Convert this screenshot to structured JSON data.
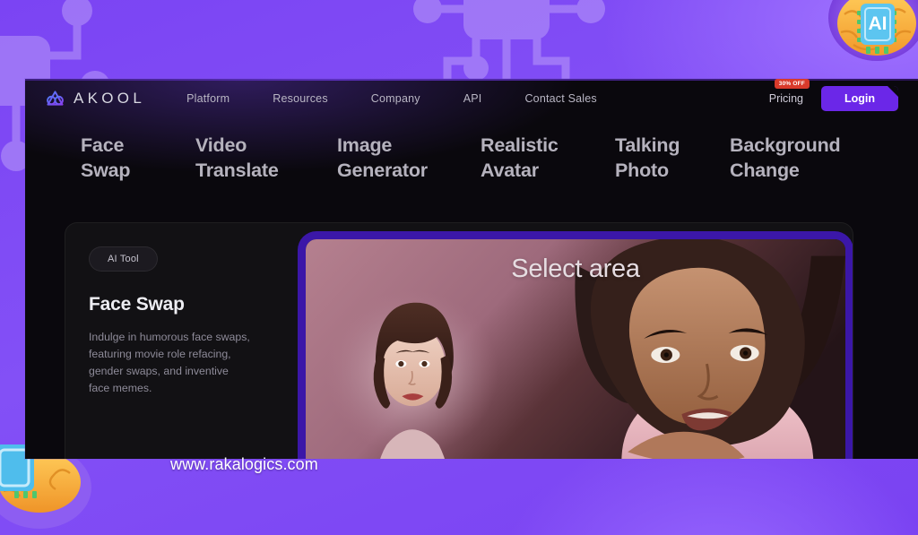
{
  "brand": {
    "logo_word": "AKOOL",
    "logo_icon": "akool-triangle-logo"
  },
  "topnav": {
    "links": [
      {
        "label": "Platform"
      },
      {
        "label": "Resources"
      },
      {
        "label": "Company"
      },
      {
        "label": "API"
      },
      {
        "label": "Contact Sales"
      }
    ],
    "pricing_label": "Pricing",
    "discount_badge": "30% OFF",
    "login_label": "Login",
    "accent_color": "#6b27e8",
    "badge_color": "#d93a2b"
  },
  "categories": [
    {
      "label": "Face\nSwap"
    },
    {
      "label": "Video\nTranslate"
    },
    {
      "label": "Image\nGenerator"
    },
    {
      "label": "Realistic\nAvatar"
    },
    {
      "label": "Talking\nPhoto"
    },
    {
      "label": "Background\nChange"
    }
  ],
  "card": {
    "chip_label": "AI Tool",
    "title": "Face Swap",
    "description": "Indulge in humorous face swaps, featuring movie role refacing, gender swaps, and inventive face memes.",
    "media_overlay_label": "Select area",
    "media_frame_color": "#3b17a8"
  },
  "watermark": {
    "text": "www.rakalogics.com"
  },
  "background": {
    "base_color": "#7d46f5",
    "decorations": [
      {
        "name": "circuit-pattern-left"
      },
      {
        "name": "circuit-chip-ai-top"
      },
      {
        "name": "brain-ai-chip-top-right"
      },
      {
        "name": "brain-ai-chip-bottom-left"
      }
    ],
    "chip_label": "AI"
  }
}
